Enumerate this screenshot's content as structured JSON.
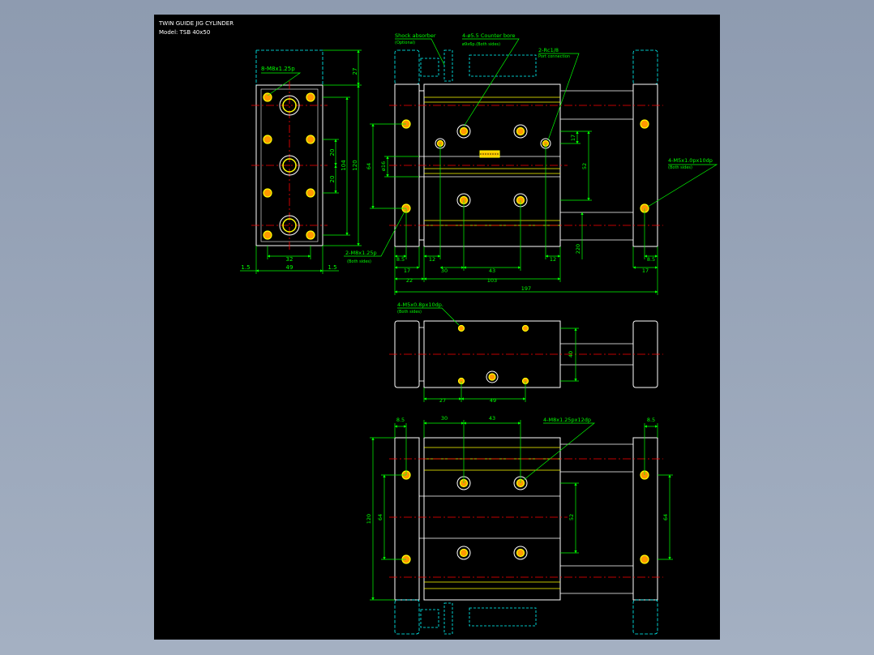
{
  "title_block": {
    "title": "TWIN GUIDE JIG CYLINDER",
    "model": "Model: TSB 40x50"
  },
  "colors": {
    "background": "#000000",
    "outline": "#ffffff",
    "dimension": "#00ff00",
    "center_line": "#ff0000",
    "hidden_line": "#00ffff",
    "thread": "#ffff00",
    "hole_fill": "#ff9900"
  },
  "end_view": {
    "callout_holes": "8-M8x1.25p",
    "dim_top": "27",
    "dim_20a": "20",
    "dim_20b": "20",
    "dim_104": "104",
    "dim_120": "120",
    "dim_32": "32",
    "dim_49": "49",
    "dim_1_5_left": "1.5",
    "dim_1_5_right": "1.5"
  },
  "top_view": {
    "callout_shock": "Shock absorber",
    "callout_shock_sub": "(Optional)",
    "callout_counterbore": "4-ø5.5 Counter bore",
    "callout_counterbore_sub": "ø9x6p.(Both sides)",
    "callout_port": "2-Rc1/8",
    "callout_port_sub": "Port connection",
    "callout_m5": "4-M5x1.0px10dp",
    "callout_m5_sub": "(Both sides)",
    "callout_m8": "2-M8x1.25p",
    "callout_m8_sub": "(Both sides)",
    "dim_64": "64",
    "dim_16": "ø16",
    "dim_17v": "17",
    "dim_52": "52",
    "dim_220": "220",
    "dim_8_5_left": "8.5",
    "dim_12_left": "12",
    "dim_12_right": "12",
    "dim_8_5_right": "8.5",
    "dim_17_left": "17",
    "dim_30": "30",
    "dim_43": "43",
    "dim_17_right": "17",
    "dim_22": "22",
    "dim_103": "103",
    "dim_197": "197"
  },
  "side_view": {
    "callout": "4-M5x0.8px10dp.",
    "callout_sub": "(Both sides)",
    "dim_40": "40",
    "dim_27": "27",
    "dim_49": "49"
  },
  "bottom_view": {
    "callout": "4-M8x1.25px12dp",
    "dim_8_5_left": "8.5",
    "dim_30": "30",
    "dim_43": "43",
    "dim_8_5_right": "8.5",
    "dim_120": "120",
    "dim_64_left": "64",
    "dim_52": "52",
    "dim_64_right": "64"
  }
}
